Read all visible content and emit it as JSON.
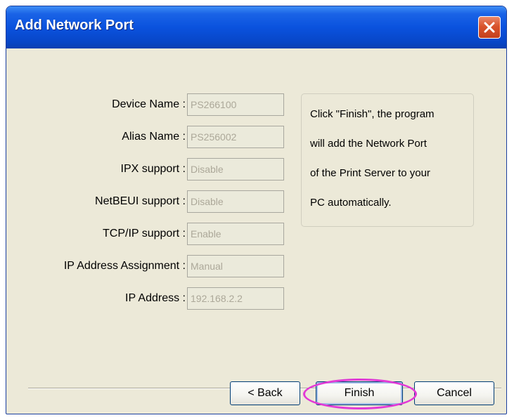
{
  "window": {
    "title": "Add Network Port"
  },
  "form": {
    "fields": [
      {
        "label": "Device Name :",
        "value": "PS266100"
      },
      {
        "label": "Alias Name :",
        "value": "PS256002"
      },
      {
        "label": "IPX support :",
        "value": "Disable"
      },
      {
        "label": "NetBEUI support :",
        "value": "Disable"
      },
      {
        "label": "TCP/IP support :",
        "value": "Enable"
      },
      {
        "label": "IP Address Assignment :",
        "value": "Manual"
      },
      {
        "label": "IP Address :",
        "value": "192.168.2.2"
      }
    ]
  },
  "info": {
    "lines": [
      "Click \"Finish\", the program",
      "will add the Network Port",
      "of the Print Server to your",
      "PC automatically."
    ]
  },
  "buttons": {
    "back": "< Back",
    "finish": "Finish",
    "cancel": "Cancel"
  },
  "colors": {
    "titlebar": "#0a52de",
    "dialog_bg": "#ece9d8",
    "highlight": "#e23ad6",
    "close": "#d9532c"
  }
}
